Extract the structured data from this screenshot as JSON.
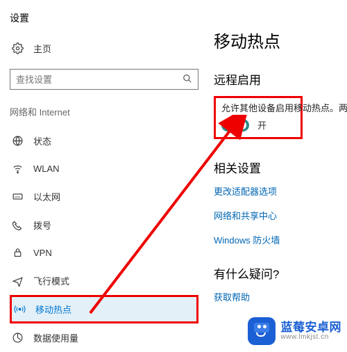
{
  "window_title": "设置",
  "home_label": "主页",
  "search": {
    "placeholder": "查找设置"
  },
  "section_label": "网络和 Internet",
  "nav": {
    "status": "状态",
    "wlan": "WLAN",
    "ethernet": "以太网",
    "dialup": "拨号",
    "vpn": "VPN",
    "airplane": "飞行模式",
    "hotspot": "移动热点",
    "datausage": "数据使用量"
  },
  "right": {
    "heading": "移动热点",
    "remote_title": "远程启用",
    "remote_desc": "允许其他设备启用移动热点。两个",
    "toggle_state": "开",
    "related_title": "相关设置",
    "link_adapter": "更改适配器选项",
    "link_sharing": "网络和共享中心",
    "link_firewall": "Windows 防火墙",
    "help_title": "有什么疑问?",
    "link_help": "获取帮助"
  },
  "watermark": {
    "line1": "蓝莓安卓网",
    "line2": "www.lmkjst.cn"
  }
}
